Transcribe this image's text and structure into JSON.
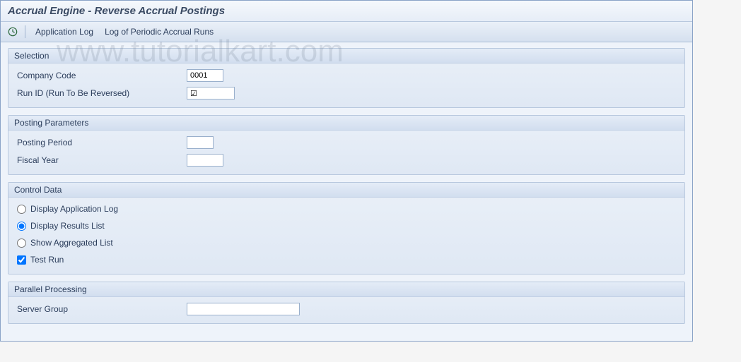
{
  "title": "Accrual Engine - Reverse Accrual Postings",
  "toolbar": {
    "execute_icon": "execute",
    "app_log_label": "Application Log",
    "periodic_log_label": "Log of Periodic Accrual Runs"
  },
  "watermark": "www.tutorialkart.com",
  "groups": {
    "selection": {
      "title": "Selection",
      "company_code_label": "Company Code",
      "company_code_value": "0001",
      "run_id_label": "Run ID (Run To Be Reversed)",
      "run_id_value": "",
      "run_id_checked": true
    },
    "posting": {
      "title": "Posting Parameters",
      "posting_period_label": "Posting Period",
      "posting_period_value": "",
      "fiscal_year_label": "Fiscal Year",
      "fiscal_year_value": ""
    },
    "control": {
      "title": "Control Data",
      "options": [
        {
          "label": "Display Application Log",
          "selected": false
        },
        {
          "label": "Display Results List",
          "selected": true
        },
        {
          "label": "Show Aggregated List",
          "selected": false
        }
      ],
      "test_run_label": "Test Run",
      "test_run_checked": true
    },
    "parallel": {
      "title": "Parallel Processing",
      "server_group_label": "Server Group",
      "server_group_value": ""
    }
  }
}
